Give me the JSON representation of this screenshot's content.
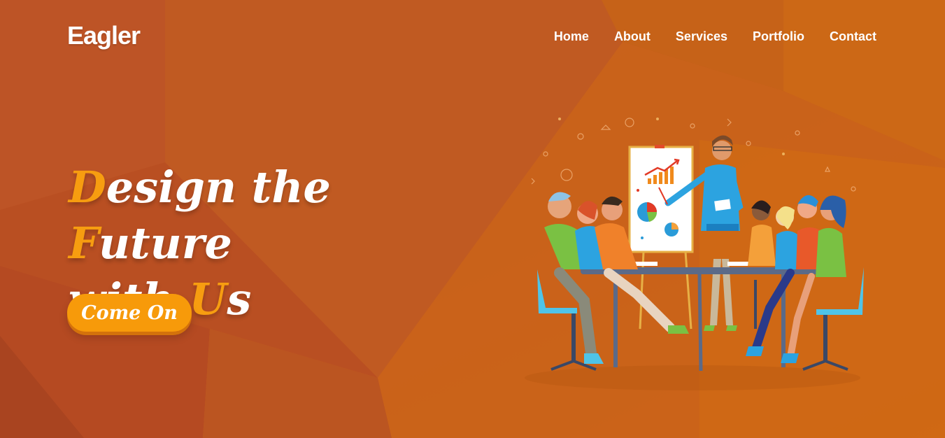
{
  "brand": {
    "name": "Eagler"
  },
  "nav": {
    "items": [
      {
        "label": "Home"
      },
      {
        "label": "About"
      },
      {
        "label": "Services"
      },
      {
        "label": "Portfolio"
      },
      {
        "label": "Contact"
      }
    ]
  },
  "hero": {
    "line1": {
      "a1": "D",
      "b1": "esign the ",
      "a2": "F",
      "b2": "uture"
    },
    "line2": {
      "b1": "with ",
      "a1": "U",
      "b2": "s"
    },
    "cta_label": "Come On"
  },
  "illustration": {
    "icon": "team-meeting-illustration"
  },
  "colors": {
    "background": "#c4581f",
    "accent": "#f79d10",
    "button": "#f79a0a",
    "text": "#ffffff"
  }
}
